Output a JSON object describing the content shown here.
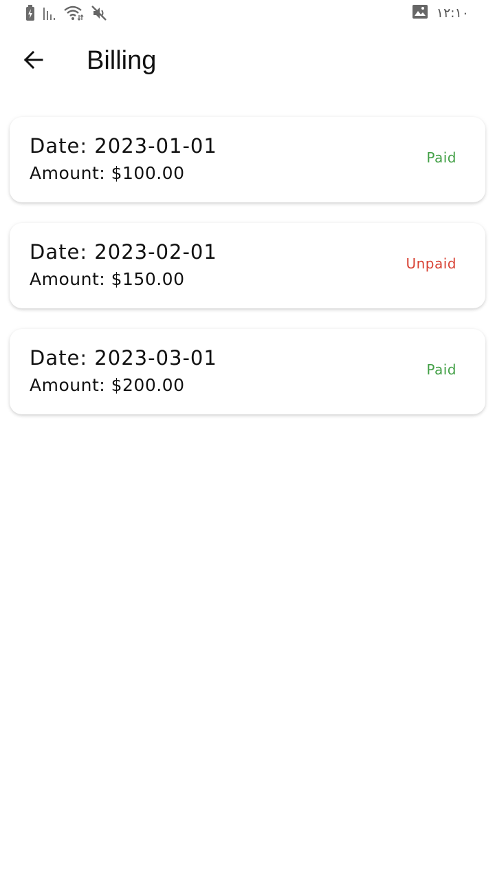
{
  "status_bar": {
    "time": "١٢:١٠",
    "icons": [
      "battery-charging-icon",
      "signal-icon",
      "wifi-icon",
      "mute-icon",
      "image-icon"
    ]
  },
  "app_bar": {
    "title": "Billing",
    "back_icon": "arrow-back-icon"
  },
  "colors": {
    "paid": "#43a047",
    "unpaid": "#d84335",
    "text": "#111111",
    "background": "#ffffff"
  },
  "bills": [
    {
      "date": "Date: 2023-01-01",
      "amount": "Amount: $100.00",
      "status": "Paid",
      "paid": true
    },
    {
      "date": "Date: 2023-02-01",
      "amount": "Amount: $150.00",
      "status": "Unpaid",
      "paid": false
    },
    {
      "date": "Date: 2023-03-01",
      "amount": "Amount: $200.00",
      "status": "Paid",
      "paid": true
    }
  ]
}
